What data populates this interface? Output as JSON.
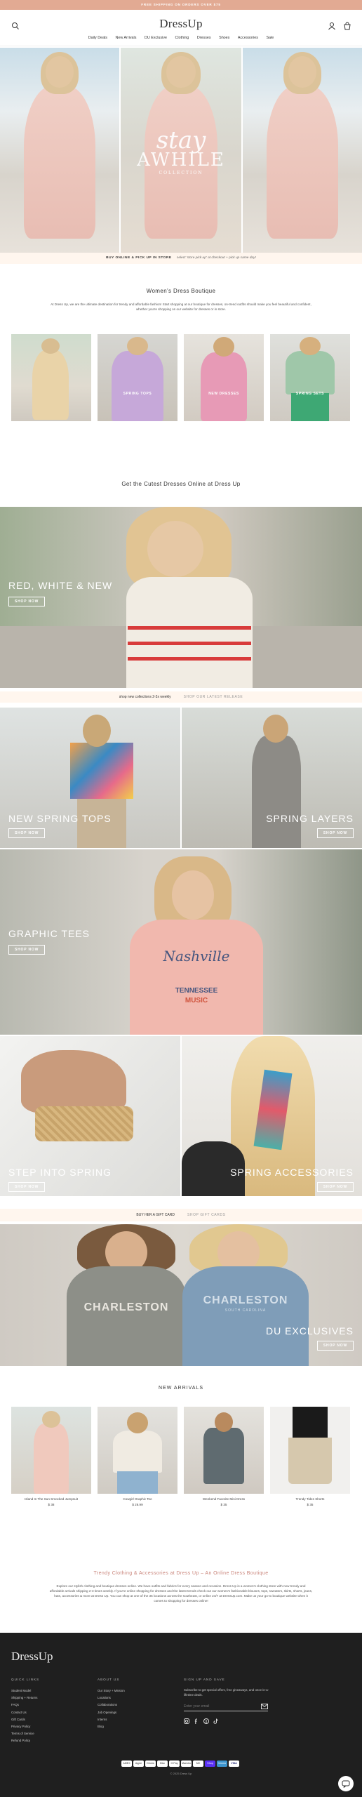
{
  "promo": {
    "text": "FREE SHIPPING ON ORDERS OVER $75"
  },
  "header": {
    "logo": "DressUp",
    "nav": [
      "Daily Deals",
      "New Arrivals",
      "DU Exclusive",
      "Clothing",
      "Dresses",
      "Shoes",
      "Accessories",
      "Sale"
    ]
  },
  "hero": {
    "script": "stay",
    "big": "AWHILE",
    "small": "COLLECTION",
    "bar_main": "BUY ONLINE & PICK UP IN STORE",
    "bar_sub": "select 'store pick up' at checkout + pick up same day!"
  },
  "intro": {
    "title": "Women's Dress Boutique",
    "body": "At Dress Up, we are the ultimate destination for trendy and affordable fashion! Start shopping at our boutique for dresses, on-trend outfits should make you feel beautiful and confident, whether you're shopping on our website for dresses or in store."
  },
  "categories": [
    {
      "label": ""
    },
    {
      "label": "SPRING TOPS"
    },
    {
      "label": "NEW DRESSES"
    },
    {
      "label": "SPRING SETS"
    }
  ],
  "cutest": {
    "title": "Get the Cutest Dresses Online at Dress Up"
  },
  "rwb": {
    "title": "RED, WHITE & NEW",
    "button": "SHOP NOW"
  },
  "band1": {
    "text": "shop new collections 2-3x weekly",
    "link": "SHOP OUR LATEST RELEASE"
  },
  "tiles": {
    "spring_tops": {
      "title": "NEW SPRING TOPS",
      "button": "SHOP NOW"
    },
    "spring_layers": {
      "title": "SPRING LAYERS",
      "button": "SHOP NOW"
    },
    "graphic_tees": {
      "title": "GRAPHIC TEES",
      "button": "SHOP NOW"
    },
    "step_spring": {
      "title": "STEP INTO SPRING",
      "button": "SHOP NOW"
    },
    "spring_acc": {
      "title": "SPRING ACCESSORIES",
      "button": "SHOP NOW"
    },
    "tee_text1": "Nashville",
    "tee_text2": "TENNESSEE",
    "tee_text3": "MUSIC"
  },
  "band2": {
    "text": "BUY HER A GIFT CARD",
    "link": "SHOP GIFT CARDS"
  },
  "du_exclusives": {
    "title": "DU EXCLUSIVES",
    "button": "SHOP NOW",
    "sweat1": "CHARLESTON",
    "sweat2": "CHARLESTON",
    "sweat2_sub": "SOUTH CAROLINA"
  },
  "new_arrivals": {
    "title": "NEW ARRIVALS",
    "products": [
      {
        "name": "Island In The Sun Smocked Jumpsuit",
        "price": "$ 38"
      },
      {
        "name": "Cowgirl Graphic Tee",
        "price": "$ 28.99"
      },
      {
        "name": "Weekend Favorite Mini Dress",
        "price": "$ 35"
      },
      {
        "name": "Trendy Tides Shorts",
        "price": "$ 35"
      }
    ]
  },
  "seo": {
    "title": "Trendy Clothing & Accessories at Dress Up – An Online Dress Boutique",
    "body": "Explore our stylish clothing and boutique dresses online. We have outfits and fabrics for every season and occasion. Dress Up is a women's clothing store with new trendy and affordable arrivals shipping 2-3 times weekly. If you're online shopping for dresses and the latest trends check out our women's fashionable blouses, tops, sweaters, skirts, shorts, jeans, hats, accessories & more at Dress Up. You can shop at one of the 35 locations across the southeast, or online 24/7 at DressUp.com. Make us your go-to boutique website when it comes to shopping for dresses online!"
  },
  "footer": {
    "logo": "DressUp",
    "quick_links_title": "QUICK LINKS",
    "quick_links": [
      "Student Model",
      "Shipping + Returns",
      "FAQs",
      "Contact Us",
      "Gift Cards",
      "Privacy Policy",
      "Terms of Service",
      "Refund Policy"
    ],
    "about_title": "ABOUT US",
    "about_links": [
      "Our Story + Mission",
      "Locations",
      "Collaborations",
      "Job Openings",
      "Interns",
      "Blog"
    ],
    "signup_title": "SIGN UP AND SAVE",
    "signup_text": "Subscribe to get special offers, free giveaways, and once-in-a-lifetime deals.",
    "email_placeholder": "Enter your email",
    "payments": [
      "AMEX",
      "Apple",
      "Diners",
      "Disc",
      "G Pay",
      "Maestro",
      "MC",
      "Shop",
      "Venmo",
      "VISA"
    ],
    "copyright": "© 2025 Dress Up"
  }
}
